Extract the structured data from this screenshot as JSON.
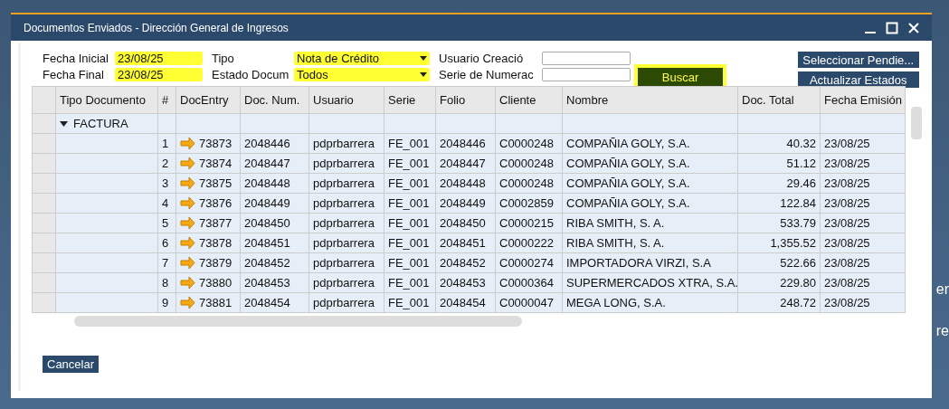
{
  "window": {
    "title": "Documentos Enviados - Dirección General de Ingresos"
  },
  "filters": [
    {
      "label": "Fecha Inicial",
      "kind": "input",
      "value": "23/08/25",
      "highlighted": true
    },
    {
      "label": "Tipo",
      "kind": "select",
      "value": "Nota de Crédito",
      "highlighted": true
    },
    {
      "label": "Usuario Creació",
      "kind": "input",
      "highlighted": false
    },
    {
      "label": "Fecha Final",
      "kind": "input",
      "value": "23/08/25",
      "highlighted": true
    },
    {
      "label": "Estado Docum",
      "kind": "select",
      "value": "Todos",
      "highlighted": true
    },
    {
      "label": "Serie de Numerac",
      "kind": "input",
      "highlighted": false
    }
  ],
  "search_button": {
    "label": "Buscar",
    "highlighted": true
  },
  "side_buttons": [
    "Seleccionar Pendie...",
    "Actualizar Estados"
  ],
  "table": {
    "columns": [
      "Tipo Documento",
      "#",
      "DocEntry",
      "Doc. Num.",
      "Usuario",
      "Serie",
      "Folio",
      "Cliente",
      "Nombre",
      "Doc. Total",
      "Fecha Emisión"
    ],
    "group": {
      "label": "FACTURA",
      "expanded": true
    },
    "rows": [
      [
        "",
        "1",
        "73873",
        "2048446",
        "pdprbarrera",
        "FE_001",
        "2048446",
        "C0000248",
        "COMPAÑIA GOLY, S.A.",
        "40.32",
        "23/08/25"
      ],
      [
        "",
        "2",
        "73874",
        "2048447",
        "pdprbarrera",
        "FE_001",
        "2048447",
        "C0000248",
        "COMPAÑIA GOLY, S.A.",
        "51.12",
        "23/08/25"
      ],
      [
        "",
        "3",
        "73875",
        "2048448",
        "pdprbarrera",
        "FE_001",
        "2048448",
        "C0000248",
        "COMPAÑIA GOLY, S.A.",
        "29.46",
        "23/08/25"
      ],
      [
        "",
        "4",
        "73876",
        "2048449",
        "pdprbarrera",
        "FE_001",
        "2048449",
        "C0002859",
        "COMPAÑIA GOLY, S.A.",
        "122.84",
        "23/08/25"
      ],
      [
        "",
        "5",
        "73877",
        "2048450",
        "pdprbarrera",
        "FE_001",
        "2048450",
        "C0000215",
        "RIBA SMITH, S. A.",
        "533.79",
        "23/08/25"
      ],
      [
        "",
        "6",
        "73878",
        "2048451",
        "pdprbarrera",
        "FE_001",
        "2048451",
        "C0000222",
        "RIBA SMITH, S. A.",
        "1,355.52",
        "23/08/25"
      ],
      [
        "",
        "7",
        "73879",
        "2048452",
        "pdprbarrera",
        "FE_001",
        "2048452",
        "C0000274",
        "IMPORTADORA VIRZI, S.A",
        "522.66",
        "23/08/25"
      ],
      [
        "",
        "8",
        "73880",
        "2048453",
        "pdprbarrera",
        "FE_001",
        "2048453",
        "C0000364",
        "SUPERMERCADOS XTRA, S.A.",
        "229.80",
        "23/08/25"
      ],
      [
        "",
        "9",
        "73881",
        "2048454",
        "pdprbarrera",
        "FE_001",
        "2048454",
        "C0000047",
        "MEGA LONG, S.A.",
        "248.72",
        "23/08/25"
      ]
    ]
  },
  "cancel_button": "Cancelar",
  "background_fragments": [
    "er",
    "re"
  ]
}
